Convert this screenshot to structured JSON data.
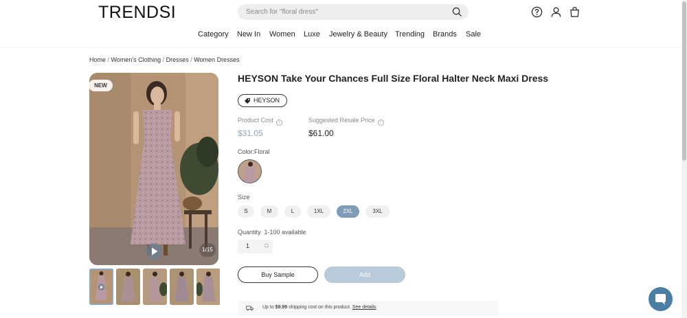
{
  "header": {
    "logo": "TRENDSI",
    "search_placeholder": "Search for \"floral dress\""
  },
  "nav": [
    "Category",
    "New In",
    "Women",
    "Luxe",
    "Jewelry & Beauty",
    "Trending",
    "Brands",
    "Sale"
  ],
  "breadcrumb": [
    "Home",
    "Women's Clothing",
    "Dresses",
    "Women Dresses"
  ],
  "gallery": {
    "badge": "NEW",
    "counter": "1/15"
  },
  "product": {
    "title": "HEYSON Take Your Chances Full Size Floral Halter Neck Maxi Dress",
    "brand": "HEYSON",
    "cost_label": "Product Cost",
    "cost": "$31.05",
    "resale_label": "Suggested Resale Price",
    "resale": "$61.00",
    "color_label": "Color:Floral",
    "size_label": "Size",
    "sizes": [
      "S",
      "M",
      "L",
      "1XL",
      "2XL",
      "3XL"
    ],
    "selected_size": "2XL",
    "quantity_label": "Quantity",
    "availability": "1-100 available",
    "quantity": "1",
    "buy_sample": "Buy Sample",
    "add": "Add"
  },
  "shipping": {
    "prefix": "Up to",
    "amount": "$9.99",
    "suffix": "shipping cost on this product.",
    "link": "See details"
  },
  "colors": {
    "accent": "#7f9cb8",
    "cost": "#8ea6bd",
    "add_button": "#b9cbda",
    "chat": "#4a7ea4"
  },
  "icons": [
    "search-icon",
    "help-icon",
    "user-icon",
    "bag-icon",
    "tag-icon",
    "info-icon",
    "play-icon",
    "truck-icon",
    "chat-icon"
  ]
}
